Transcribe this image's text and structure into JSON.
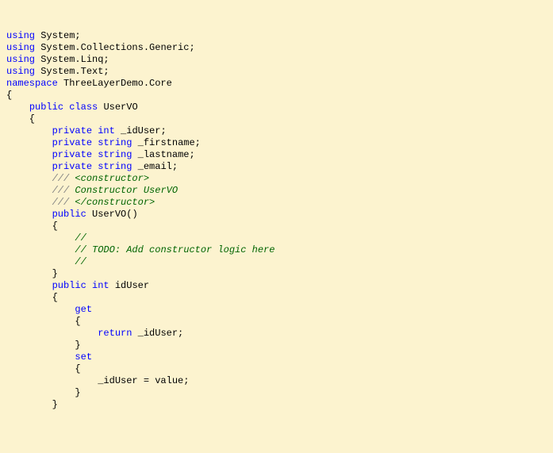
{
  "lines": [
    [
      [
        "kw",
        "using"
      ],
      [
        "",
        " System;"
      ]
    ],
    [
      [
        "kw",
        "using"
      ],
      [
        "",
        " System.Collections.Generic;"
      ]
    ],
    [
      [
        "kw",
        "using"
      ],
      [
        "",
        " System.Linq;"
      ]
    ],
    [
      [
        "kw",
        "using"
      ],
      [
        "",
        " System.Text;"
      ]
    ],
    [
      [
        "",
        ""
      ]
    ],
    [
      [
        "kw",
        "namespace"
      ],
      [
        "",
        " ThreeLayerDemo.Core"
      ]
    ],
    [
      [
        "",
        "{"
      ]
    ],
    [
      [
        "",
        "    "
      ],
      [
        "kw",
        "public"
      ],
      [
        "",
        " "
      ],
      [
        "kw",
        "class"
      ],
      [
        "",
        " UserVO"
      ]
    ],
    [
      [
        "",
        "    {"
      ]
    ],
    [
      [
        "",
        "        "
      ],
      [
        "kw",
        "private"
      ],
      [
        "",
        " "
      ],
      [
        "kw",
        "int"
      ],
      [
        "",
        " _idUser;"
      ]
    ],
    [
      [
        "",
        "        "
      ],
      [
        "kw",
        "private"
      ],
      [
        "",
        " "
      ],
      [
        "kw",
        "string"
      ],
      [
        "",
        " _firstname;"
      ]
    ],
    [
      [
        "",
        "        "
      ],
      [
        "kw",
        "private"
      ],
      [
        "",
        " "
      ],
      [
        "kw",
        "string"
      ],
      [
        "",
        " _lastname;"
      ]
    ],
    [
      [
        "",
        "        "
      ],
      [
        "kw",
        "private"
      ],
      [
        "",
        " "
      ],
      [
        "kw",
        "string"
      ],
      [
        "",
        " _email;"
      ]
    ],
    [
      [
        "",
        ""
      ]
    ],
    [
      [
        "",
        "        "
      ],
      [
        "cm",
        "///"
      ],
      [
        "",
        " "
      ],
      [
        "xmlcm",
        "<constructor>"
      ]
    ],
    [
      [
        "",
        "        "
      ],
      [
        "cm",
        "///"
      ],
      [
        "",
        " "
      ],
      [
        "xmlcm",
        "Constructor UserVO"
      ]
    ],
    [
      [
        "",
        "        "
      ],
      [
        "cm",
        "///"
      ],
      [
        "",
        " "
      ],
      [
        "xmlcm",
        "</constructor>"
      ]
    ],
    [
      [
        "",
        "        "
      ],
      [
        "kw",
        "public"
      ],
      [
        "",
        " UserVO()"
      ]
    ],
    [
      [
        "",
        "        {"
      ]
    ],
    [
      [
        "",
        "            "
      ],
      [
        "xmlcm",
        "//"
      ]
    ],
    [
      [
        "",
        "            "
      ],
      [
        "xmlcm",
        "// TODO: Add constructor logic here"
      ]
    ],
    [
      [
        "",
        "            "
      ],
      [
        "xmlcm",
        "//"
      ]
    ],
    [
      [
        "",
        "        }"
      ]
    ],
    [
      [
        "",
        ""
      ]
    ],
    [
      [
        "",
        "        "
      ],
      [
        "kw",
        "public"
      ],
      [
        "",
        " "
      ],
      [
        "kw",
        "int"
      ],
      [
        "",
        " idUser"
      ]
    ],
    [
      [
        "",
        "        {"
      ]
    ],
    [
      [
        "",
        "            "
      ],
      [
        "kw",
        "get"
      ]
    ],
    [
      [
        "",
        "            {"
      ]
    ],
    [
      [
        "",
        "                "
      ],
      [
        "kw",
        "return"
      ],
      [
        "",
        " _idUser;"
      ]
    ],
    [
      [
        "",
        "            }"
      ]
    ],
    [
      [
        "",
        ""
      ]
    ],
    [
      [
        "",
        "            "
      ],
      [
        "kw",
        "set"
      ]
    ],
    [
      [
        "",
        "            {"
      ]
    ],
    [
      [
        "",
        "                _idUser = value;"
      ]
    ],
    [
      [
        "",
        "            }"
      ]
    ],
    [
      [
        "",
        "        }"
      ]
    ]
  ]
}
